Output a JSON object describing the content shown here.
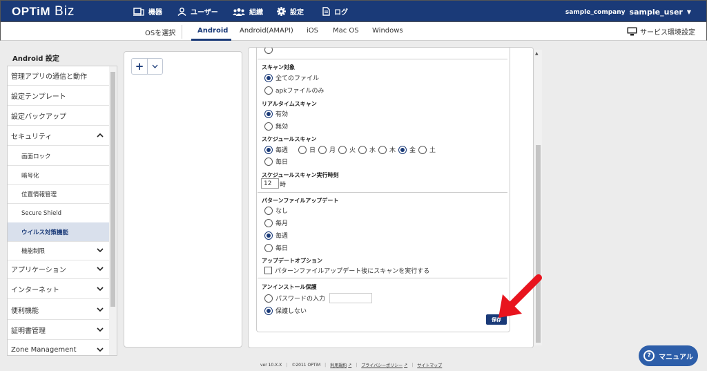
{
  "brand": {
    "logo": "OPTiM",
    "product": "Biz",
    "accent": "#1a3a78",
    "highlight_arrow": "#e8141e"
  },
  "nav": {
    "items": [
      {
        "label": "機器",
        "icon": "device-icon"
      },
      {
        "label": "ユーザー",
        "icon": "user-icon"
      },
      {
        "label": "組織",
        "icon": "group-icon"
      },
      {
        "label": "設定",
        "icon": "gear-icon"
      },
      {
        "label": "ログ",
        "icon": "log-icon"
      }
    ],
    "company": "sample_company",
    "user": "sample_user"
  },
  "osbar": {
    "select_label": "OSを選択",
    "tabs": [
      "Android",
      "Android(AMAPI)",
      "iOS",
      "Mac OS",
      "Windows"
    ],
    "selected": "Android",
    "service_settings": "サービス環境設定"
  },
  "sidebar": {
    "title": "Android 設定",
    "items": [
      {
        "label": "管理アプリの通信と動作"
      },
      {
        "label": "設定テンプレート"
      },
      {
        "label": "設定バックアップ"
      },
      {
        "label": "セキュリティ"
      },
      {
        "label": "画面ロック"
      },
      {
        "label": "暗号化"
      },
      {
        "label": "位置情報管理"
      },
      {
        "label": "Secure Shield"
      },
      {
        "label": "ウイルス対策機能"
      },
      {
        "label": "機能制限"
      },
      {
        "label": "アプリケーション"
      },
      {
        "label": "インターネット"
      },
      {
        "label": "便利機能"
      },
      {
        "label": "証明書管理"
      },
      {
        "label": "Zone Management"
      }
    ]
  },
  "form": {
    "scan_target": {
      "title": "スキャン対象",
      "opt_all": "全てのファイル",
      "opt_apk": "apkファイルのみ",
      "selected": "全てのファイル"
    },
    "realtime": {
      "title": "リアルタイムスキャン",
      "opt_on": "有効",
      "opt_off": "無効",
      "selected": "有効"
    },
    "schedule": {
      "title": "スケジュールスキャン",
      "weekly": "毎週",
      "daily": "毎日",
      "days": [
        "日",
        "月",
        "火",
        "水",
        "木",
        "金",
        "土"
      ],
      "selected_day": "金",
      "selected": "毎週"
    },
    "schedule_time": {
      "title": "スケジュールスキャン実行時刻",
      "hour": "12",
      "unit": "時"
    },
    "pattern_update": {
      "title": "パターンファイルアップデート",
      "opts": [
        "なし",
        "毎月",
        "毎週",
        "毎日"
      ],
      "selected": "毎週"
    },
    "update_option": {
      "title": "アップデートオプション",
      "check_label": "パターンファイルアップデート後にスキャンを実行する"
    },
    "uninstall": {
      "title": "アンインストール保護",
      "opt_pw": "パスワードの入力",
      "opt_none": "保護しない",
      "selected": "保護しない"
    },
    "save": "保存"
  },
  "footer": {
    "version": "ver 10.X.X",
    "copyright": "©2011 OPTiM",
    "terms": "利用規約",
    "privacy": "プライバシーポリシー",
    "sitemap": "サイトマップ"
  },
  "manual": "マニュアル"
}
